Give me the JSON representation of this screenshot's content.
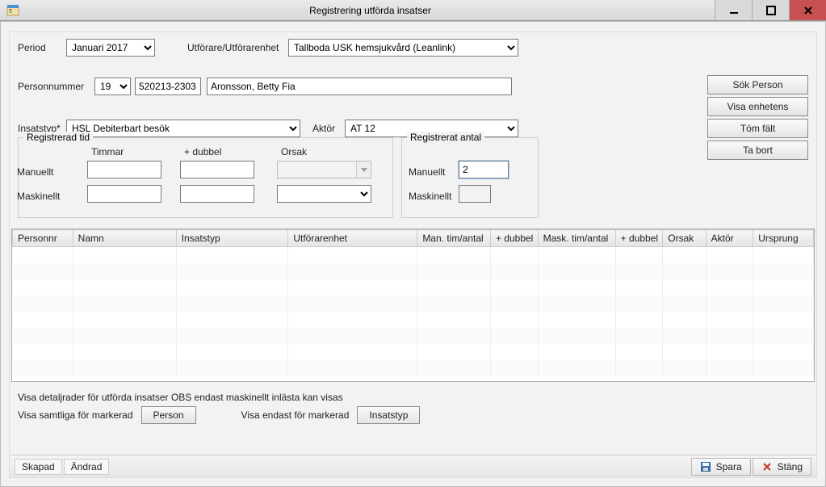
{
  "window": {
    "title": "Registrering utförda insatser"
  },
  "period": {
    "label": "Period",
    "value": "Januari 2017"
  },
  "utforare": {
    "label": "Utförare/Utförarenhet",
    "value": "Tallboda USK hemsjukvård (Leanlink)"
  },
  "personnummer": {
    "label": "Personnummer",
    "century": "19",
    "number": "520213-2303",
    "name": "Aronsson, Betty Fia"
  },
  "insatstyp": {
    "label": "Insatstyp*",
    "value": "HSL Debiterbart besök"
  },
  "aktor": {
    "label": "Aktör",
    "value": "AT 12"
  },
  "group_tid": {
    "legend": "Registrerad tid",
    "headers": {
      "timmar": "Timmar",
      "dubbel": "+ dubbel",
      "orsak": "Orsak"
    },
    "rows": {
      "manuellt": "Manuellt",
      "maskinellt": "Maskinellt"
    },
    "manuellt": {
      "timmar": "",
      "dubbel": "",
      "orsak": ""
    },
    "maskinellt": {
      "timmar": "",
      "dubbel": "",
      "orsak": ""
    }
  },
  "group_antal": {
    "legend": "Registrerat antal",
    "rows": {
      "manuellt": "Manuellt",
      "maskinellt": "Maskinellt"
    },
    "manuellt_value": "2",
    "maskinellt_value": ""
  },
  "buttons": {
    "sok": "Sök Person",
    "visa_enhetens": "Visa enhetens personer",
    "tom": "Töm fält",
    "ta_bort": "Ta bort",
    "person": "Person",
    "insatstyp": "Insatstyp",
    "spara": "Spara",
    "stang": "Stäng"
  },
  "grid": {
    "columns": [
      "Personnr",
      "Namn",
      "Insatstyp",
      "Utförarenhet",
      "Man. tim/antal",
      "+ dubbel",
      "Mask. tim/antal",
      "+ dubbel",
      "Orsak",
      "Aktör",
      "Ursprung"
    ],
    "widths": [
      70,
      120,
      130,
      150,
      85,
      55,
      90,
      55,
      50,
      55,
      70
    ],
    "rows": []
  },
  "footer": {
    "detail_text": "Visa detaljrader för utförda insatser OBS endast maskinellt inlästa kan visas",
    "visa_samtliga": "Visa samtliga för markerad",
    "visa_endast": "Visa endast för markerad"
  },
  "status": {
    "skapad": "Skapad",
    "andrad": "Ändrad"
  }
}
